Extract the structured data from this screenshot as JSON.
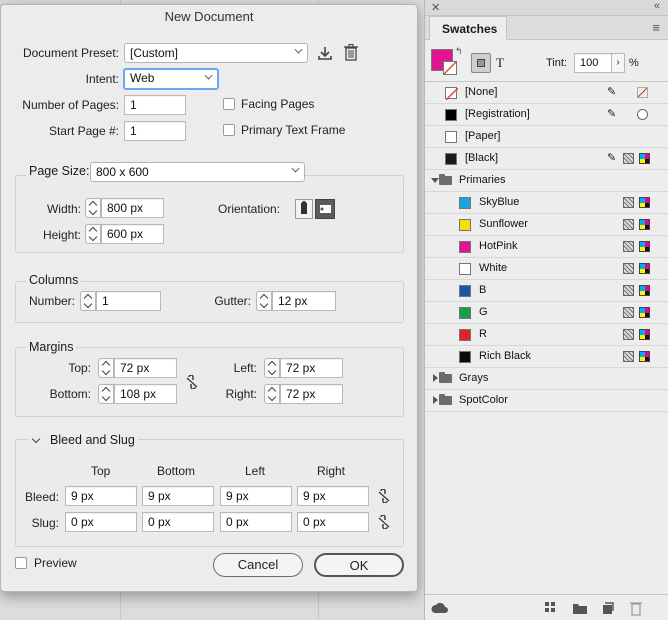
{
  "dialog": {
    "title": "New Document",
    "preset_label": "Document Preset:",
    "preset_value": "[Custom]",
    "intent_label": "Intent:",
    "intent_value": "Web",
    "pages_label": "Number of Pages:",
    "pages_value": "1",
    "start_label": "Start Page #:",
    "start_value": "1",
    "facing_label": "Facing Pages",
    "primary_label": "Primary Text Frame",
    "page_size_label": "Page Size:",
    "page_size_value": "800 x 600",
    "width_label": "Width:",
    "width_value": "800 px",
    "height_label": "Height:",
    "height_value": "600 px",
    "orientation_label": "Orientation:",
    "columns_title": "Columns",
    "number_label": "Number:",
    "number_value": "1",
    "gutter_label": "Gutter:",
    "gutter_value": "12 px",
    "margins_title": "Margins",
    "top_label": "Top:",
    "top_value": "72 px",
    "bottom_label": "Bottom:",
    "bottom_value": "108 px",
    "left_label": "Left:",
    "left_value": "72 px",
    "right_label": "Right:",
    "right_value": "72 px",
    "bleed_title": "Bleed and Slug",
    "col_top": "Top",
    "col_bottom": "Bottom",
    "col_left": "Left",
    "col_right": "Right",
    "bleed_label": "Bleed:",
    "slug_label": "Slug:",
    "bleed_values": [
      "9 px",
      "9 px",
      "9 px",
      "9 px"
    ],
    "slug_values": [
      "0 px",
      "0 px",
      "0 px",
      "0 px"
    ],
    "preview_label": "Preview",
    "cancel_label": "Cancel",
    "ok_label": "OK"
  },
  "swatches": {
    "tab_label": "Swatches",
    "tint_label": "Tint:",
    "tint_value": "100",
    "tint_unit": "%",
    "items": [
      {
        "name": "[None]",
        "color": "#ffffff"
      },
      {
        "name": "[Registration]",
        "color": "#000000"
      },
      {
        "name": "[Paper]",
        "color": "#ffffff"
      },
      {
        "name": "[Black]",
        "color": "#1a1a1a"
      },
      {
        "name": "Primaries",
        "group": true
      },
      {
        "name": "SkyBlue",
        "color": "#1aa3e0"
      },
      {
        "name": "Sunflower",
        "color": "#f5e100"
      },
      {
        "name": "HotPink",
        "color": "#e0158f"
      },
      {
        "name": "White",
        "color": "#ffffff"
      },
      {
        "name": "B",
        "color": "#1f55a8"
      },
      {
        "name": "G",
        "color": "#1a9e4b"
      },
      {
        "name": "R",
        "color": "#e0222a"
      },
      {
        "name": "Rich Black",
        "color": "#0a0a0a"
      },
      {
        "name": "Grays",
        "group": true
      },
      {
        "name": "SpotColor",
        "group": true
      }
    ],
    "fill_color": "#e0158f"
  }
}
